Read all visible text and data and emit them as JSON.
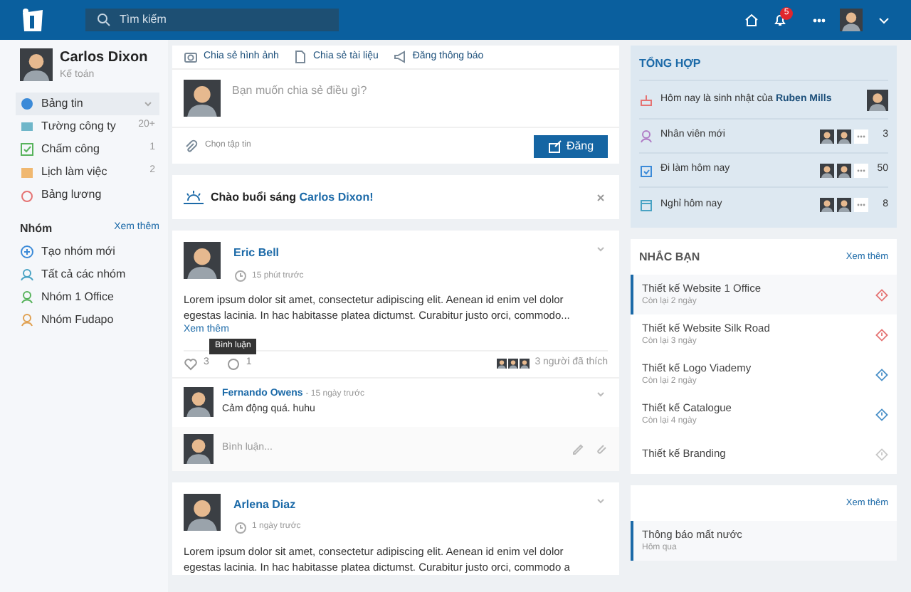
{
  "header": {
    "search_placeholder": "Tìm kiếm",
    "notification_count": "5"
  },
  "profile": {
    "name": "Carlos Dixon",
    "role": "Kế toán"
  },
  "nav": [
    {
      "label": "Bảng tin",
      "selected": true
    },
    {
      "label": "Tường công ty",
      "count": "20+",
      "selected": false
    },
    {
      "label": "Chấm công",
      "count": "1",
      "selected": false
    },
    {
      "label": "Lịch làm việc",
      "count": "2",
      "selected": false
    },
    {
      "label": "Bảng lương",
      "selected": false
    }
  ],
  "groups": {
    "title": "Nhóm",
    "more": "Xem thêm",
    "items": [
      "Tạo nhóm mới",
      "Tất cả các nhóm",
      "Nhóm 1 Office",
      "Nhóm Fudapo"
    ]
  },
  "composer": {
    "actions": [
      "Chia sẻ hình ảnh",
      "Chia sẻ tài liệu",
      "Đăng thông báo"
    ],
    "placeholder": "Bạn muốn chia sẻ điều gì?",
    "attach": "Chọn tập tin",
    "submit": "Đăng"
  },
  "greeting": {
    "text": "Chào buổi sáng",
    "name": "Carlos Dixon!"
  },
  "posts": [
    {
      "author": "Eric Bell",
      "time": "15 phút trước",
      "text": "Lorem ipsum dolor sit amet, consectetur adipiscing elit. Aenean id enim vel dolor egestas lacinia. In hac habitasse platea dictumst. Curabitur justo orci, commodo...",
      "more": "Xem thêm",
      "tooltip": "Bình luận",
      "likes": "3",
      "comments": "1",
      "liked_by": "3 người đã thích",
      "comment": {
        "author": "Fernando Owens",
        "time": "- 15 ngày trước",
        "text": "Cảm động quá. huhu"
      },
      "comment_placeholder": "Bình luận..."
    },
    {
      "author": "Arlena Diaz",
      "time": "1 ngày trước",
      "text": "Lorem ipsum dolor sit amet, consectetur adipiscing elit. Aenean id enim vel dolor egestas lacinia. In hac habitasse platea dictumst. Curabitur justo orci, commodo a"
    }
  ],
  "summary": {
    "title": "TỔNG HỢP",
    "birthday_text": "Hôm nay là sinh nhật của",
    "birthday_name": "Ruben Mills",
    "rows": [
      {
        "label": "Nhân viên mới",
        "count": "3"
      },
      {
        "label": "Đi làm hôm nay",
        "count": "50"
      },
      {
        "label": "Nghỉ hôm nay",
        "count": "8"
      }
    ]
  },
  "reminders": {
    "title": "NHẮC BẠN",
    "more": "Xem thêm",
    "items": [
      {
        "title": "Thiết kế Website 1 Office",
        "sub": "Còn lại 2 ngày",
        "selected": true,
        "color": "#e57373"
      },
      {
        "title": "Thiết kế Website Silk Road",
        "sub": "Còn lại 3 ngày",
        "selected": false,
        "color": "#e57373"
      },
      {
        "title": "Thiết kế Logo Viademy",
        "sub": "Còn lại 2 ngày",
        "selected": false,
        "color": "#4a90c8"
      },
      {
        "title": "Thiết kế Catalogue",
        "sub": "Còn lại 4 ngày",
        "selected": false,
        "color": "#4a90c8"
      },
      {
        "title": "Thiết kế Branding",
        "selected": false,
        "color": "#c8c8c8"
      }
    ]
  },
  "notices": {
    "more": "Xem thêm",
    "items": [
      {
        "title": "Thông báo mất nước",
        "sub": "Hôm qua",
        "selected": true
      }
    ]
  }
}
